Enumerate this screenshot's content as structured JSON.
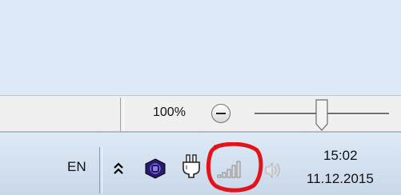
{
  "status_bar": {
    "zoom_level": "100%"
  },
  "zoom_slider": {
    "level_percent": 100
  },
  "taskbar": {
    "language": "EN",
    "tray_icons": [
      "show-hidden-icons",
      "app-tray-icon",
      "power-plug-icon",
      "network-signal-icon",
      "speaker-icon"
    ],
    "clock_time": "15:02",
    "clock_date": "11.12.2015"
  },
  "colors": {
    "annotation": "#e3131b",
    "window_bg": "#dde9f6",
    "taskbar_bg": "#c9d8ea"
  }
}
